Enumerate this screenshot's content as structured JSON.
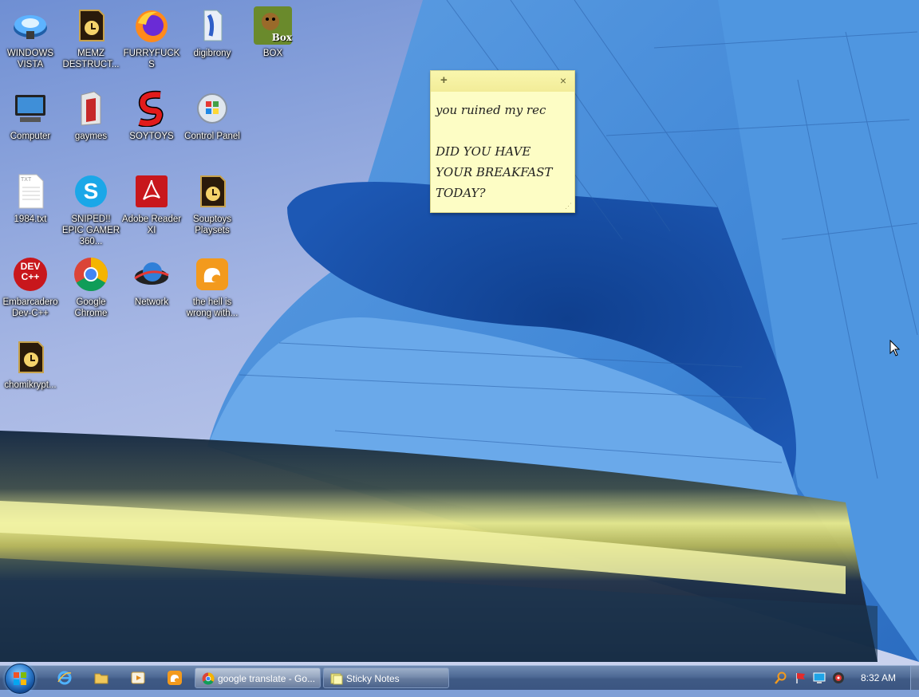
{
  "desktop": {
    "icons": [
      {
        "label": "WINDOWS VISTA"
      },
      {
        "label": "MEMZ DESTRUCT..."
      },
      {
        "label": "FURRYFUCKS"
      },
      {
        "label": "digibrony"
      },
      {
        "label": "BOX"
      },
      {
        "label": "Computer"
      },
      {
        "label": "gaymes"
      },
      {
        "label": "SOYTOYS"
      },
      {
        "label": "Control Panel"
      },
      {
        "label": "1984.txt"
      },
      {
        "label": "SNIPED!! EPIC GAMER 360..."
      },
      {
        "label": "Adobe Reader XI"
      },
      {
        "label": "Souptoys Playsets"
      },
      {
        "label": "Embarcadero Dev-C++"
      },
      {
        "label": "Google Chrome"
      },
      {
        "label": "Network"
      },
      {
        "label": "the hell is wrong with..."
      },
      {
        "label": "chomikrypt..."
      }
    ],
    "icon_text": {
      "box_badge": "Box",
      "devcpp_badge": "DEV C++",
      "txt_badge": "TXT",
      "skype_letter": "S"
    }
  },
  "sticky_note": {
    "add_glyph": "+",
    "close_glyph": "×",
    "text": "you ruined my rec\n\nDID YOU HAVE\nYOUR BREAKFAST\nTODAY?",
    "color": "#fdfdc5"
  },
  "taskbar": {
    "quick_launch": [
      "internet-explorer-icon",
      "windows-explorer-icon",
      "media-player-icon",
      "uc-browser-icon"
    ],
    "buttons": [
      {
        "label": "google translate - Go...",
        "icon": "chrome-icon"
      },
      {
        "label": "Sticky Notes",
        "icon": "sticky-notes-icon"
      }
    ],
    "tray_icons": [
      "search-icon",
      "flag-icon",
      "display-icon",
      "volume-icon"
    ],
    "clock": "8:32 AM"
  }
}
